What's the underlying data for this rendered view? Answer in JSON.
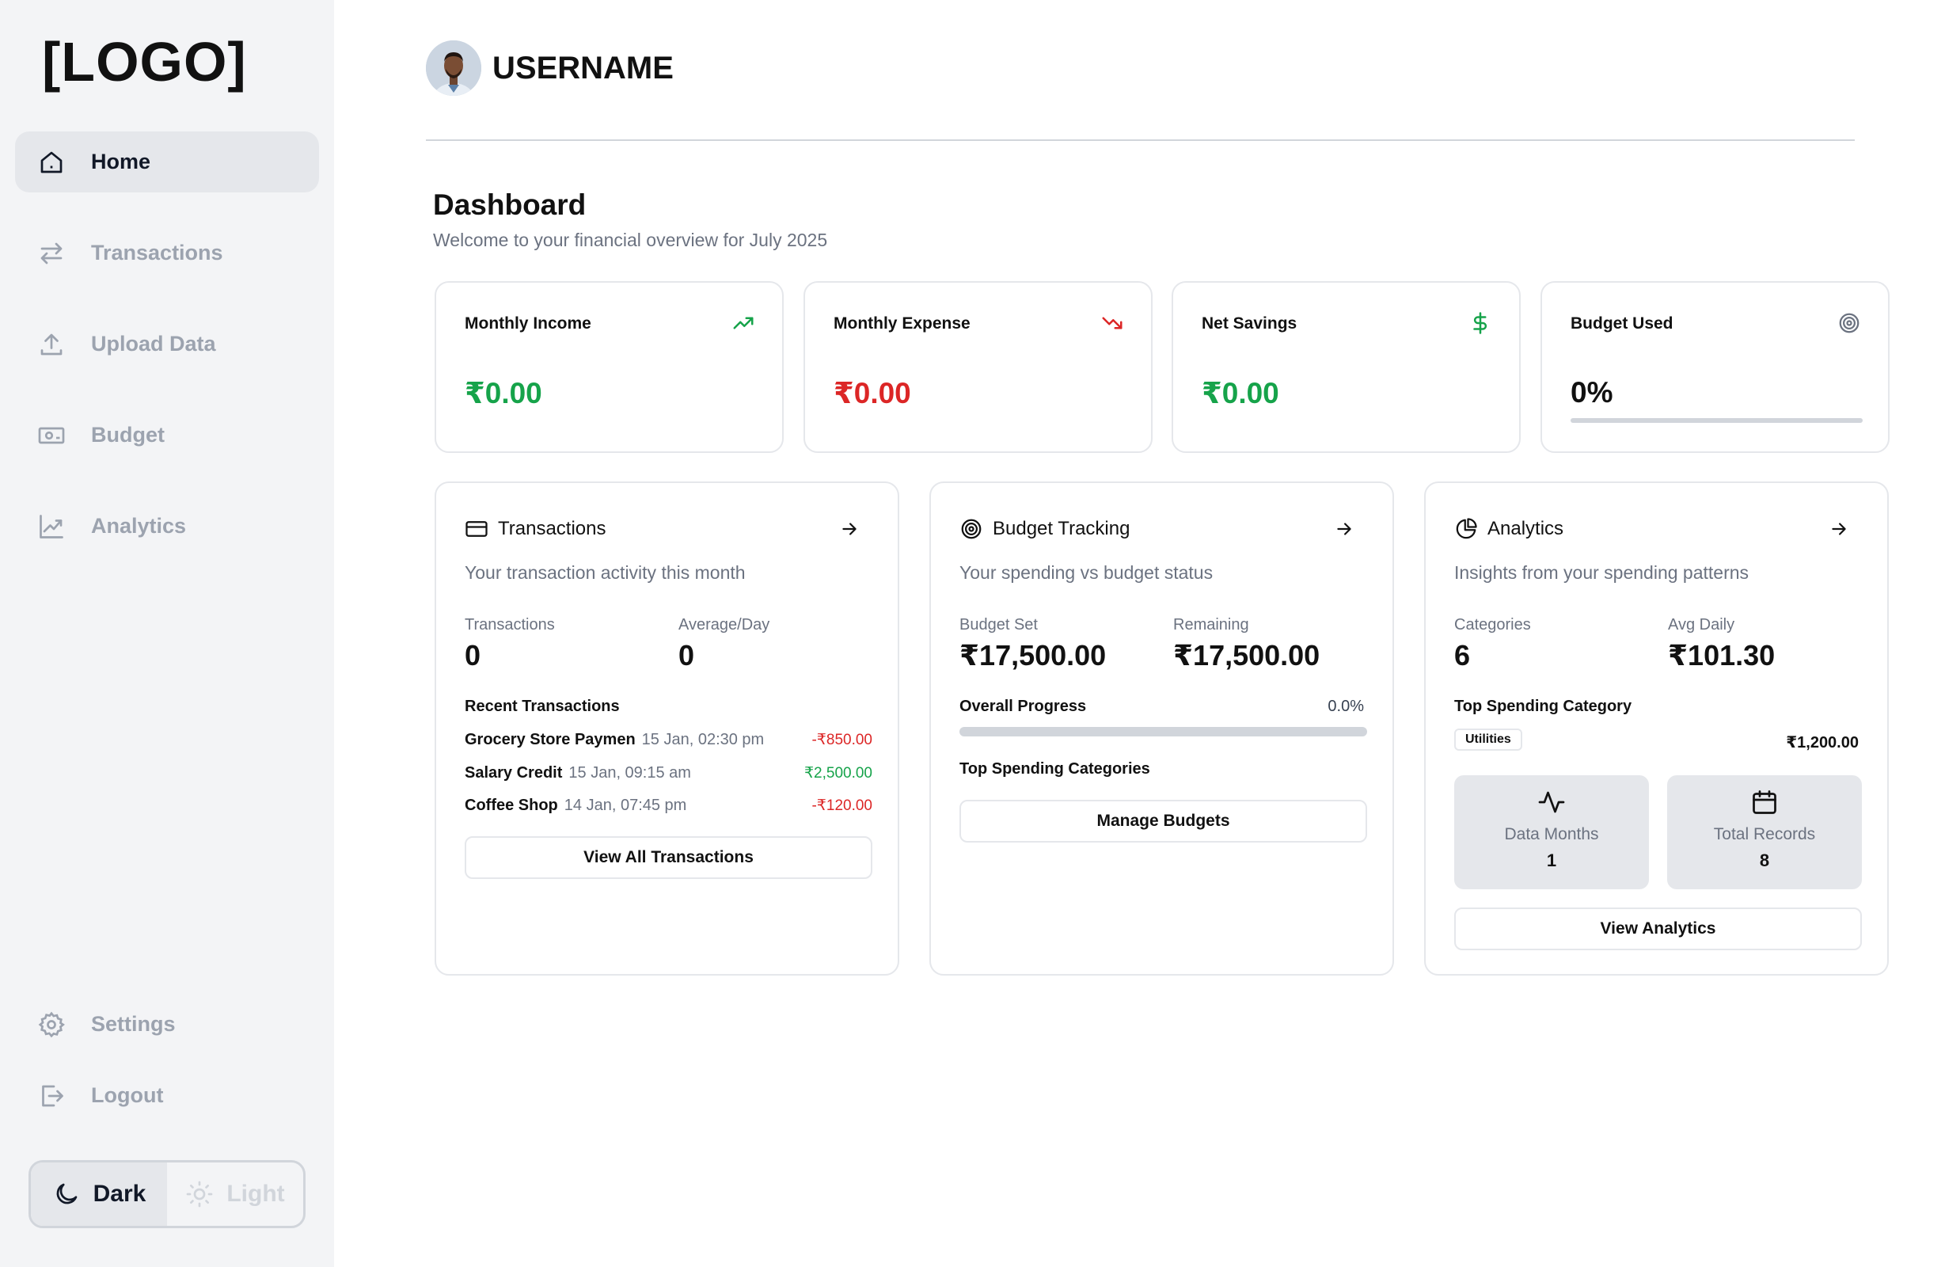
{
  "sidebar": {
    "logo": "[LOGO]",
    "items": [
      {
        "label": "Home",
        "icon": "home-icon",
        "active": true
      },
      {
        "label": "Transactions",
        "icon": "swap-arrows-icon"
      },
      {
        "label": "Upload Data",
        "icon": "upload-icon"
      },
      {
        "label": "Budget",
        "icon": "banknote-icon"
      },
      {
        "label": "Analytics",
        "icon": "chart-line-icon"
      }
    ],
    "bottom": [
      {
        "label": "Settings",
        "icon": "gear-icon"
      },
      {
        "label": "Logout",
        "icon": "logout-icon"
      }
    ],
    "theme": {
      "dark": "Dark",
      "light": "Light",
      "selected": "Dark"
    }
  },
  "header": {
    "username": "USERNAME"
  },
  "page": {
    "title": "Dashboard",
    "subtitle": "Welcome to your financial overview for July 2025"
  },
  "stats": [
    {
      "label": "Monthly Income",
      "value": "₹0.00",
      "icon": "trending-up-icon",
      "color": "#16a34a"
    },
    {
      "label": "Monthly Expense",
      "value": "₹0.00",
      "icon": "trending-down-icon",
      "color": "#dc2626"
    },
    {
      "label": "Net Savings",
      "value": "₹0.00",
      "icon": "dollar-icon",
      "color": "#16a34a"
    },
    {
      "label": "Budget Used",
      "value": "0%",
      "icon": "target-icon",
      "progress": 0
    }
  ],
  "transactions_card": {
    "title": "Transactions",
    "subtitle": "Your transaction activity this month",
    "metrics": [
      {
        "label": "Transactions",
        "value": "0"
      },
      {
        "label": "Average/Day",
        "value": "0"
      }
    ],
    "recent_title": "Recent Transactions",
    "recent": [
      {
        "name": "Grocery Store Paymen",
        "date": "15 Jan, 02:30 pm",
        "amount": "-₹850.00",
        "type": "debit"
      },
      {
        "name": "Salary Credit",
        "date": "15 Jan, 09:15 am",
        "amount": "₹2,500.00",
        "type": "credit"
      },
      {
        "name": "Coffee Shop",
        "date": "14 Jan, 07:45 pm",
        "amount": "-₹120.00",
        "type": "debit"
      }
    ],
    "button": "View All Transactions"
  },
  "budget_card": {
    "title": "Budget Tracking",
    "subtitle": "Your spending vs budget status",
    "metrics": [
      {
        "label": "Budget Set",
        "value": "₹17,500.00"
      },
      {
        "label": "Remaining",
        "value": "₹17,500.00"
      }
    ],
    "progress_label": "Overall Progress",
    "progress_value": "0.0%",
    "progress": 0,
    "top_title": "Top Spending Categories",
    "button": "Manage Budgets"
  },
  "analytics_card": {
    "title": "Analytics",
    "subtitle": "Insights from your spending patterns",
    "metrics": [
      {
        "label": "Categories",
        "value": "6"
      },
      {
        "label": "Avg Daily",
        "value": "₹101.30"
      }
    ],
    "top_title": "Top Spending Category",
    "top_category": "Utilities",
    "top_amount": "₹1,200.00",
    "tiles": [
      {
        "label": "Data Months",
        "value": "1",
        "icon": "activity-icon"
      },
      {
        "label": "Total Records",
        "value": "8",
        "icon": "calendar-icon"
      }
    ],
    "button": "View Analytics"
  }
}
